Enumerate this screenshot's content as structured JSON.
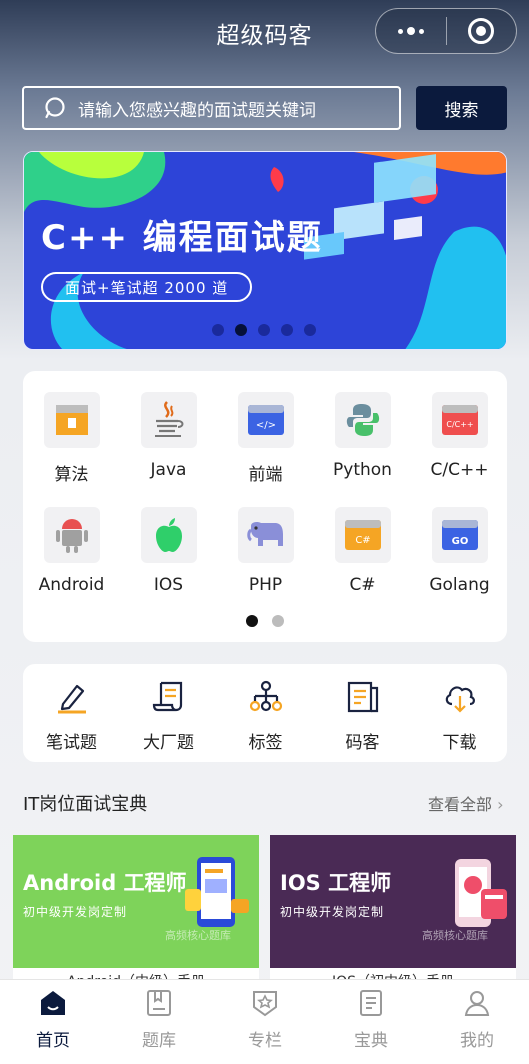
{
  "header": {
    "title": "超级码客"
  },
  "search": {
    "placeholder": "请输入您感兴趣的面试题关键词",
    "button": "搜索"
  },
  "banner": {
    "title": "C++ 编程面试题",
    "subtitle": "面试+笔试超 2000 道",
    "active_dot": 2,
    "dot_count": 5
  },
  "categories": [
    {
      "label": "算法",
      "icon": "algorithm-box-icon"
    },
    {
      "label": "Java",
      "icon": "java-cup-icon"
    },
    {
      "label": "前端",
      "icon": "frontend-code-icon"
    },
    {
      "label": "Python",
      "icon": "python-icon"
    },
    {
      "label": "C/C++",
      "icon": "cpp-icon"
    },
    {
      "label": "Android",
      "icon": "android-icon"
    },
    {
      "label": "IOS",
      "icon": "apple-icon"
    },
    {
      "label": "PHP",
      "icon": "php-elephant-icon"
    },
    {
      "label": "C#",
      "icon": "csharp-icon"
    },
    {
      "label": "Golang",
      "icon": "golang-icon"
    }
  ],
  "tools": [
    {
      "label": "笔试题",
      "icon": "pencil-icon"
    },
    {
      "label": "大厂题",
      "icon": "scroll-icon"
    },
    {
      "label": "标签",
      "icon": "hierarchy-icon"
    },
    {
      "label": "码客",
      "icon": "document-icon"
    },
    {
      "label": "下载",
      "icon": "cloud-download-icon"
    }
  ],
  "section": {
    "title": "IT岗位面试宝典",
    "more": "查看全部"
  },
  "tiles": [
    {
      "title": "Android 工程师",
      "subtitle": "初中级开发岗定制",
      "watermark": "高频核心题库",
      "caption": "Android（中级）手册",
      "bg": "#7ed35a"
    },
    {
      "title": "IOS 工程师",
      "subtitle": "初中级开发岗定制",
      "watermark": "高频核心题库",
      "caption": "IOS（初中级）手册",
      "bg": "#4a2a55"
    }
  ],
  "nav": [
    {
      "label": "首页",
      "icon": "home-icon",
      "active": true
    },
    {
      "label": "题库",
      "icon": "question-bank-icon",
      "active": false
    },
    {
      "label": "专栏",
      "icon": "column-star-icon",
      "active": false
    },
    {
      "label": "宝典",
      "icon": "book-icon",
      "active": false
    },
    {
      "label": "我的",
      "icon": "profile-icon",
      "active": false
    }
  ],
  "colors": {
    "accent": "#0b1a3d",
    "banner": "#2d44d8"
  }
}
